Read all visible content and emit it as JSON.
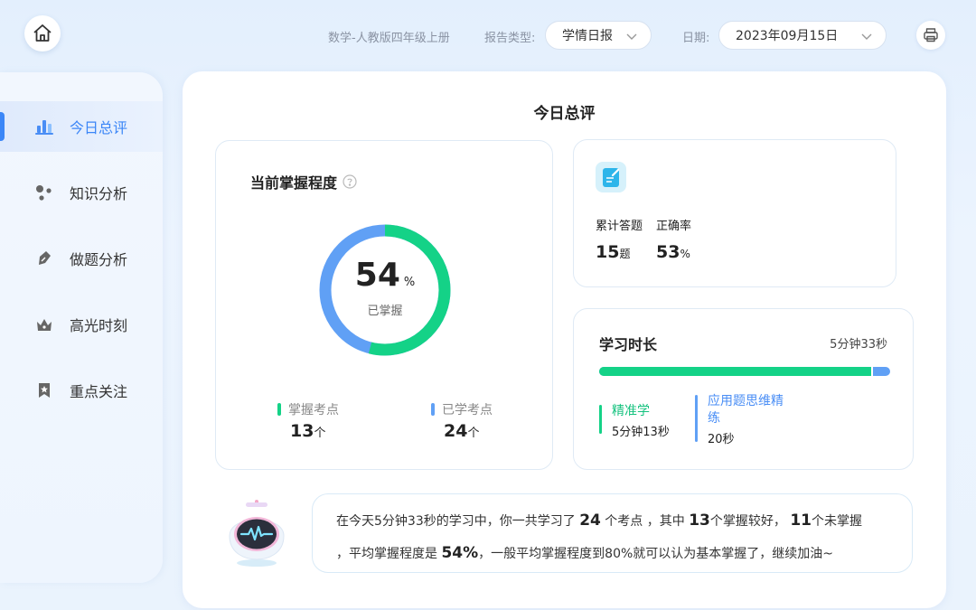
{
  "header": {
    "subject": "数学-人教版四年级上册",
    "report_type_label": "报告类型:",
    "report_type_value": "学情日报",
    "date_label": "日期:",
    "date_value": "2023年09月15日"
  },
  "sidebar": {
    "items": [
      {
        "label": "今日总评",
        "icon": "bar-chart-icon",
        "active": true
      },
      {
        "label": "知识分析",
        "icon": "molecule-icon",
        "active": false
      },
      {
        "label": "做题分析",
        "icon": "pencil-icon",
        "active": false
      },
      {
        "label": "高光时刻",
        "icon": "crown-icon",
        "active": false
      },
      {
        "label": "重点关注",
        "icon": "bookmark-star-icon",
        "active": false
      }
    ]
  },
  "main": {
    "title": "今日总评",
    "mastery": {
      "title": "当前掌握程度",
      "percent": 54,
      "percent_text": "54",
      "percent_unit": "%",
      "subtitle": "已掌握",
      "mastered_label": "掌握考点",
      "mastered_value": "13",
      "learned_label": "已学考点",
      "learned_value": "24",
      "unit": "个",
      "colors": {
        "mastered": "#14d287",
        "learned": "#60a0f5"
      }
    },
    "answers": {
      "total_label": "累计答题",
      "total_value": "15",
      "total_unit": "题",
      "accuracy_label": "正确率",
      "accuracy_value": "53",
      "accuracy_unit": "%"
    },
    "duration": {
      "title": "学习时长",
      "total": "5分钟33秒",
      "total_seconds": 333,
      "items": [
        {
          "name": "精准学",
          "value": "5分钟13秒",
          "seconds": 313,
          "color": "#14d287"
        },
        {
          "name": "应用题思维精练",
          "value": "20秒",
          "seconds": 20,
          "color": "#60a0f5"
        }
      ]
    },
    "summary": {
      "p1": "在今天5分钟33秒的学习中，你一共学习了",
      "n1": "24",
      "p2": " 个考点 ，其中",
      "n2": "13",
      "p3": "个掌握较好，",
      "n3": "11",
      "p4": "个未掌握",
      "p5": "，平均掌握程度是",
      "n4": "54%",
      "p6": "，一般平均掌握程度到80%就可以认为基本掌握了，继续加油~"
    }
  }
}
